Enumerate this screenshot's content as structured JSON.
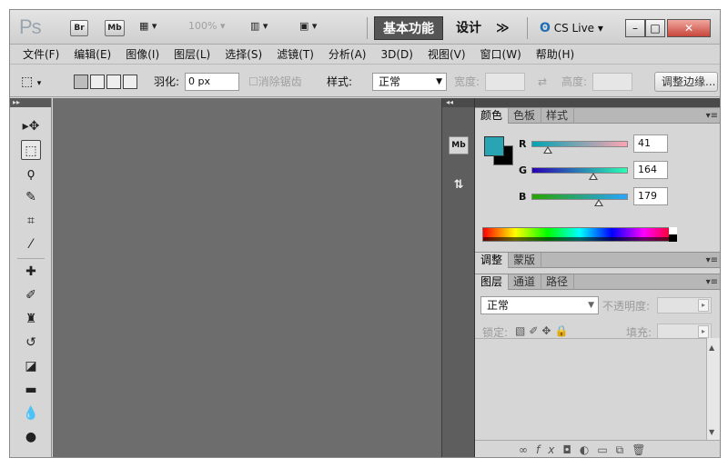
{
  "app": {
    "logo": "Ps",
    "bridge_label": "Br",
    "minibridge_label": "Mb",
    "zoom": "100%",
    "workspace_active": "基本功能",
    "workspace_design": "设计",
    "workspace_more": "≫",
    "cslive": "CS Live",
    "win_min": "–",
    "win_max": "□",
    "win_close": "✕"
  },
  "menus": [
    "文件(F)",
    "编辑(E)",
    "图像(I)",
    "图层(L)",
    "选择(S)",
    "滤镜(T)",
    "分析(A)",
    "3D(D)",
    "视图(V)",
    "窗口(W)",
    "帮助(H)"
  ],
  "options": {
    "feather_label": "羽化:",
    "feather_value": "0 px",
    "antialias_label": "消除锯齿",
    "style_label": "样式:",
    "style_value": "正常",
    "width_label": "宽度:",
    "height_label": "高度:",
    "refine_edge": "调整边缘..."
  },
  "color_panel": {
    "tabs": [
      "颜色",
      "色板",
      "样式"
    ],
    "foreground_color": "#29a4b3",
    "background_color": "#000000",
    "channels": [
      {
        "name": "R",
        "value": "41",
        "fraction": 0.161
      },
      {
        "name": "G",
        "value": "164",
        "fraction": 0.643
      },
      {
        "name": "B",
        "value": "179",
        "fraction": 0.702
      }
    ]
  },
  "adjust_panel": {
    "tabs": [
      "调整",
      "蒙版"
    ]
  },
  "layers_panel": {
    "tabs": [
      "图层",
      "通道",
      "路径"
    ],
    "blend_mode": "正常",
    "opacity_label": "不透明度:",
    "lock_label": "锁定:",
    "fill_label": "填充:",
    "footer_icons": [
      "link-icon",
      "fx-icon",
      "mask-icon",
      "adjustment-icon",
      "group-icon",
      "new-layer-icon",
      "trash-icon"
    ]
  }
}
